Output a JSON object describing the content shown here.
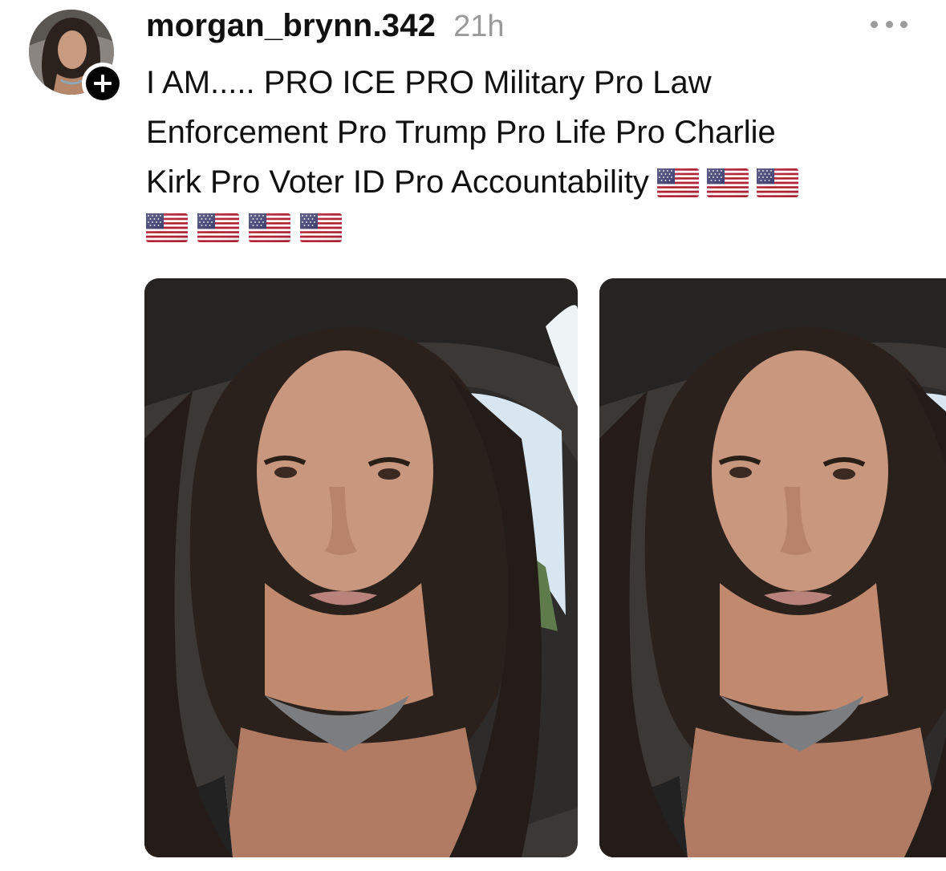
{
  "post": {
    "username": "morgan_brynn.342",
    "timestamp": "21h",
    "caption_lines": [
      "I AM..... PRO ICE PRO Military Pro Law",
      "Enforcement Pro Trump Pro Life Pro Charlie",
      "Kirk Pro Voter ID Pro Accountability"
    ],
    "flag_emoji_count": 7,
    "media": [
      {
        "type": "photo",
        "subject": "selfie-in-car"
      },
      {
        "type": "photo",
        "subject": "selfie-in-car"
      }
    ]
  },
  "icons": {
    "follow": "plus-icon",
    "more": "more-options-icon",
    "flag": "us-flag-icon"
  },
  "colors": {
    "text": "#111111",
    "muted": "#9a9a9a",
    "background": "#ffffff"
  }
}
